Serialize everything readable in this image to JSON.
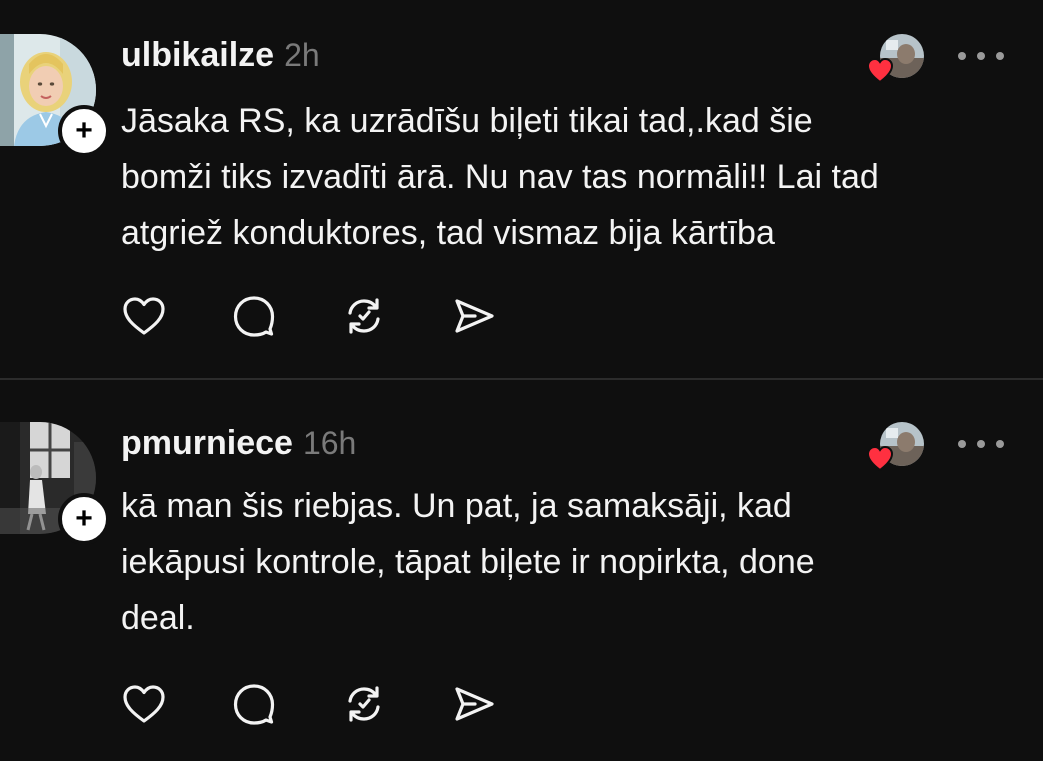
{
  "posts": [
    {
      "username": "ulbikailze",
      "time": "2h",
      "text": "Jāsaka RS, ka uzrādīšu biļeti tikai tad,.kad šie\nbomži tiks izvadīti ārā. Nu nav tas normāli!! Lai tad\natgriež konduktores, tad vismaz bija kārtība",
      "follow_symbol": "+",
      "avatar_icon": "profile-photo",
      "liker_icon": "liker-avatar",
      "liker_heart_color": "#ff3040",
      "actions": [
        "like-icon",
        "comment-icon",
        "repost-icon",
        "share-icon"
      ]
    },
    {
      "username": "pmurniece",
      "time": "16h",
      "text": "kā man šis riebjas. Un pat, ja samaksāji, kad\niekāpusi kontrole, tāpat biļete ir nopirkta, done\ndeal.",
      "follow_symbol": "+",
      "avatar_icon": "profile-photo",
      "liker_icon": "liker-avatar",
      "liker_heart_color": "#ff3040",
      "actions": [
        "like-icon",
        "comment-icon",
        "repost-icon",
        "share-icon"
      ]
    }
  ],
  "colors": {
    "background": "#0f0f0f",
    "text": "#f3f3f3",
    "muted": "#7a7a7a",
    "divider": "#2c2c2c",
    "heart": "#ff3040"
  }
}
